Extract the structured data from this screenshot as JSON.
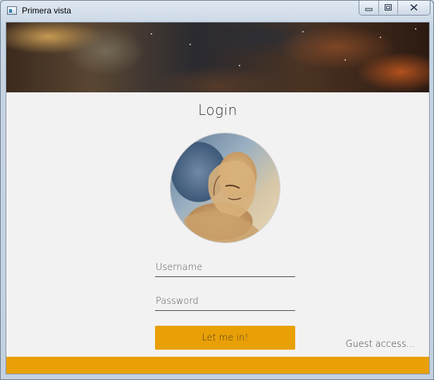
{
  "window": {
    "title": "Primera vista",
    "controls": [
      "minimize",
      "maximize",
      "close"
    ]
  },
  "banner": {
    "image": "nebula-space-banner"
  },
  "login": {
    "title": "Login",
    "avatar": "painted-portrait-avatar",
    "username_placeholder": "Username",
    "password_placeholder": "Password",
    "submit_label": "Let me in!",
    "guest_label": "Guest access..."
  },
  "colors": {
    "accent": "#e9a007",
    "background": "#f3f2f3"
  }
}
